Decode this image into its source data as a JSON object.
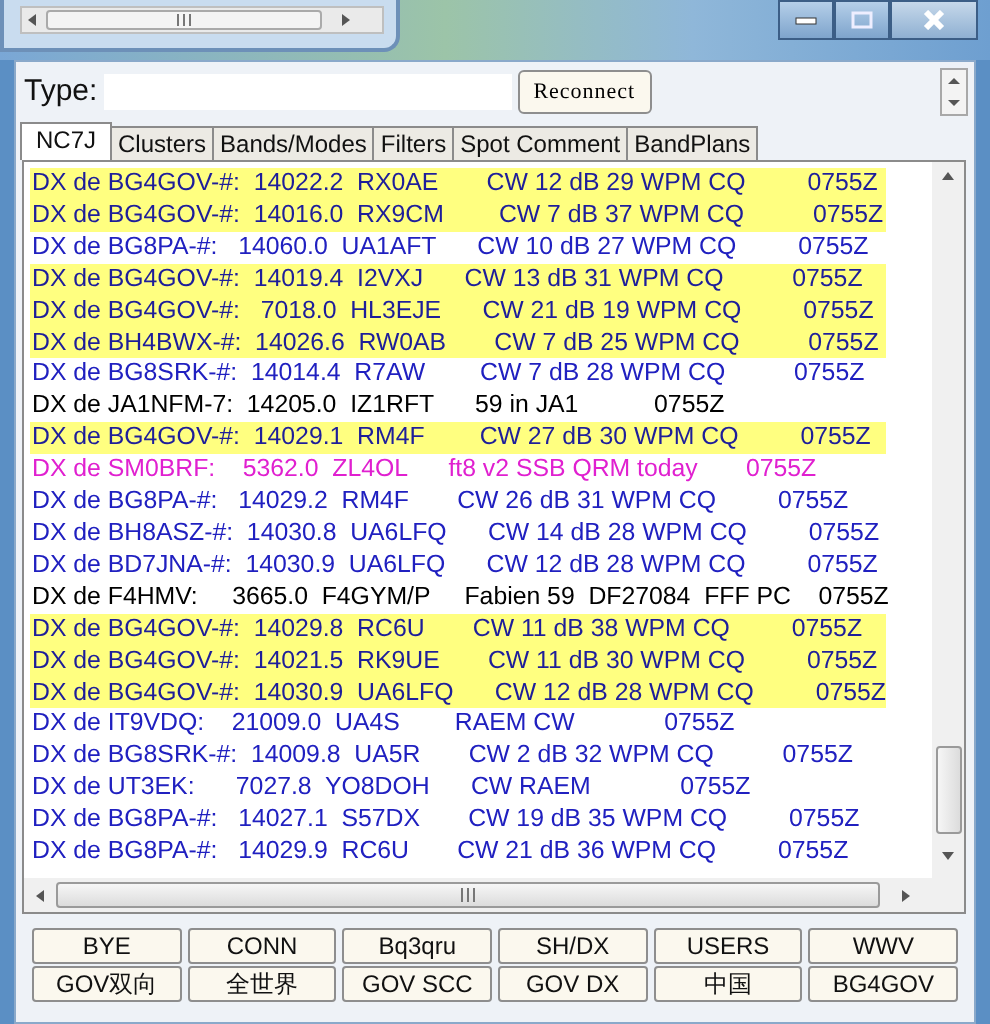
{
  "type_field": {
    "label": "Type:"
  },
  "reconnect_button": "Reconnect",
  "tabs": [
    {
      "label": "NC7J",
      "selected": true
    },
    {
      "label": "Clusters",
      "selected": false
    },
    {
      "label": "Bands/Modes",
      "selected": false
    },
    {
      "label": "Filters",
      "selected": false
    },
    {
      "label": "Spot Comment",
      "selected": false
    },
    {
      "label": "BandPlans",
      "selected": false
    }
  ],
  "spots": [
    {
      "text": "DX de BG4GOV-#:  14022.2  RX0AE       CW 12 dB 29 WPM CQ         0755Z",
      "color": "#1e1e9a",
      "highlighted": true
    },
    {
      "text": "DX de BG4GOV-#:  14016.0  RX9CM        CW 7 dB 37 WPM CQ          0755Z",
      "color": "#1e1e9a",
      "highlighted": true
    },
    {
      "text": "DX de BG8PA-#:   14060.0  UA1AFT      CW 10 dB 27 WPM CQ         0755Z",
      "color": "#2020c0",
      "highlighted": false
    },
    {
      "text": "DX de BG4GOV-#:  14019.4  I2VXJ      CW 13 dB 31 WPM CQ          0755Z",
      "color": "#1e1e9a",
      "highlighted": true
    },
    {
      "text": "DX de BG4GOV-#:   7018.0  HL3EJE      CW 21 dB 19 WPM CQ         0755Z",
      "color": "#1e1e9a",
      "highlighted": true
    },
    {
      "text": "DX de BH4BWX-#:  14026.6  RW0AB       CW 7 dB 25 WPM CQ          0755Z",
      "color": "#1e1e9a",
      "highlighted": true
    },
    {
      "text": "DX de BG8SRK-#:  14014.4  R7AW        CW 7 dB 28 WPM CQ          0755Z",
      "color": "#2020c0",
      "highlighted": false
    },
    {
      "text": "DX de JA1NFM-7:  14205.0  IZ1RFT      59 in JA1           0755Z",
      "color": "#000000",
      "highlighted": false
    },
    {
      "text": "DX de BG4GOV-#:  14029.1  RM4F        CW 27 dB 30 WPM CQ         0755Z",
      "color": "#1e1e9a",
      "highlighted": true
    },
    {
      "text": "DX de SM0BRF:    5362.0  ZL4OL      ft8 v2 SSB QRM today       0755Z",
      "color": "#e020d0",
      "highlighted": false
    },
    {
      "text": "DX de BG8PA-#:   14029.2  RM4F       CW 26 dB 31 WPM CQ         0755Z",
      "color": "#2020c0",
      "highlighted": false
    },
    {
      "text": "DX de BH8ASZ-#:  14030.8  UA6LFQ      CW 14 dB 28 WPM CQ         0755Z",
      "color": "#2020c0",
      "highlighted": false
    },
    {
      "text": "DX de BD7JNA-#:  14030.9  UA6LFQ      CW 12 dB 28 WPM CQ         0755Z",
      "color": "#2020c0",
      "highlighted": false
    },
    {
      "text": "DX de F4HMV:     3665.0  F4GYM/P     Fabien 59  DF27084  FFF PC    0755Z",
      "color": "#000000",
      "highlighted": false
    },
    {
      "text": "DX de BG4GOV-#:  14029.8  RC6U       CW 11 dB 38 WPM CQ         0755Z",
      "color": "#1e1e9a",
      "highlighted": true
    },
    {
      "text": "DX de BG4GOV-#:  14021.5  RK9UE       CW 11 dB 30 WPM CQ         0755Z",
      "color": "#1e1e9a",
      "highlighted": true
    },
    {
      "text": "DX de BG4GOV-#:  14030.9  UA6LFQ      CW 12 dB 28 WPM CQ         0755Z",
      "color": "#1e1e9a",
      "highlighted": true
    },
    {
      "text": "DX de IT9VDQ:    21009.0  UA4S        RAEM CW             0755Z",
      "color": "#2020c0",
      "highlighted": false
    },
    {
      "text": "DX de BG8SRK-#:  14009.8  UA5R       CW 2 dB 32 WPM CQ          0755Z",
      "color": "#2020c0",
      "highlighted": false
    },
    {
      "text": "DX de UT3EK:      7027.8  YO8DOH      CW RAEM             0755Z",
      "color": "#2020c0",
      "highlighted": false
    },
    {
      "text": "DX de BG8PA-#:   14027.1  S57DX       CW 19 dB 35 WPM CQ         0755Z",
      "color": "#2020c0",
      "highlighted": false
    },
    {
      "text": "DX de BG8PA-#:   14029.9  RC6U       CW 21 dB 36 WPM CQ         0755Z",
      "color": "#2020c0",
      "highlighted": false
    }
  ],
  "buttons": [
    "BYE",
    "CONN",
    "Bq3qru",
    "SH/DX",
    "USERS",
    "WWV",
    "GOV双向",
    "全世界",
    "GOV SCC",
    "GOV  DX",
    "中国",
    "BG4GOV"
  ]
}
